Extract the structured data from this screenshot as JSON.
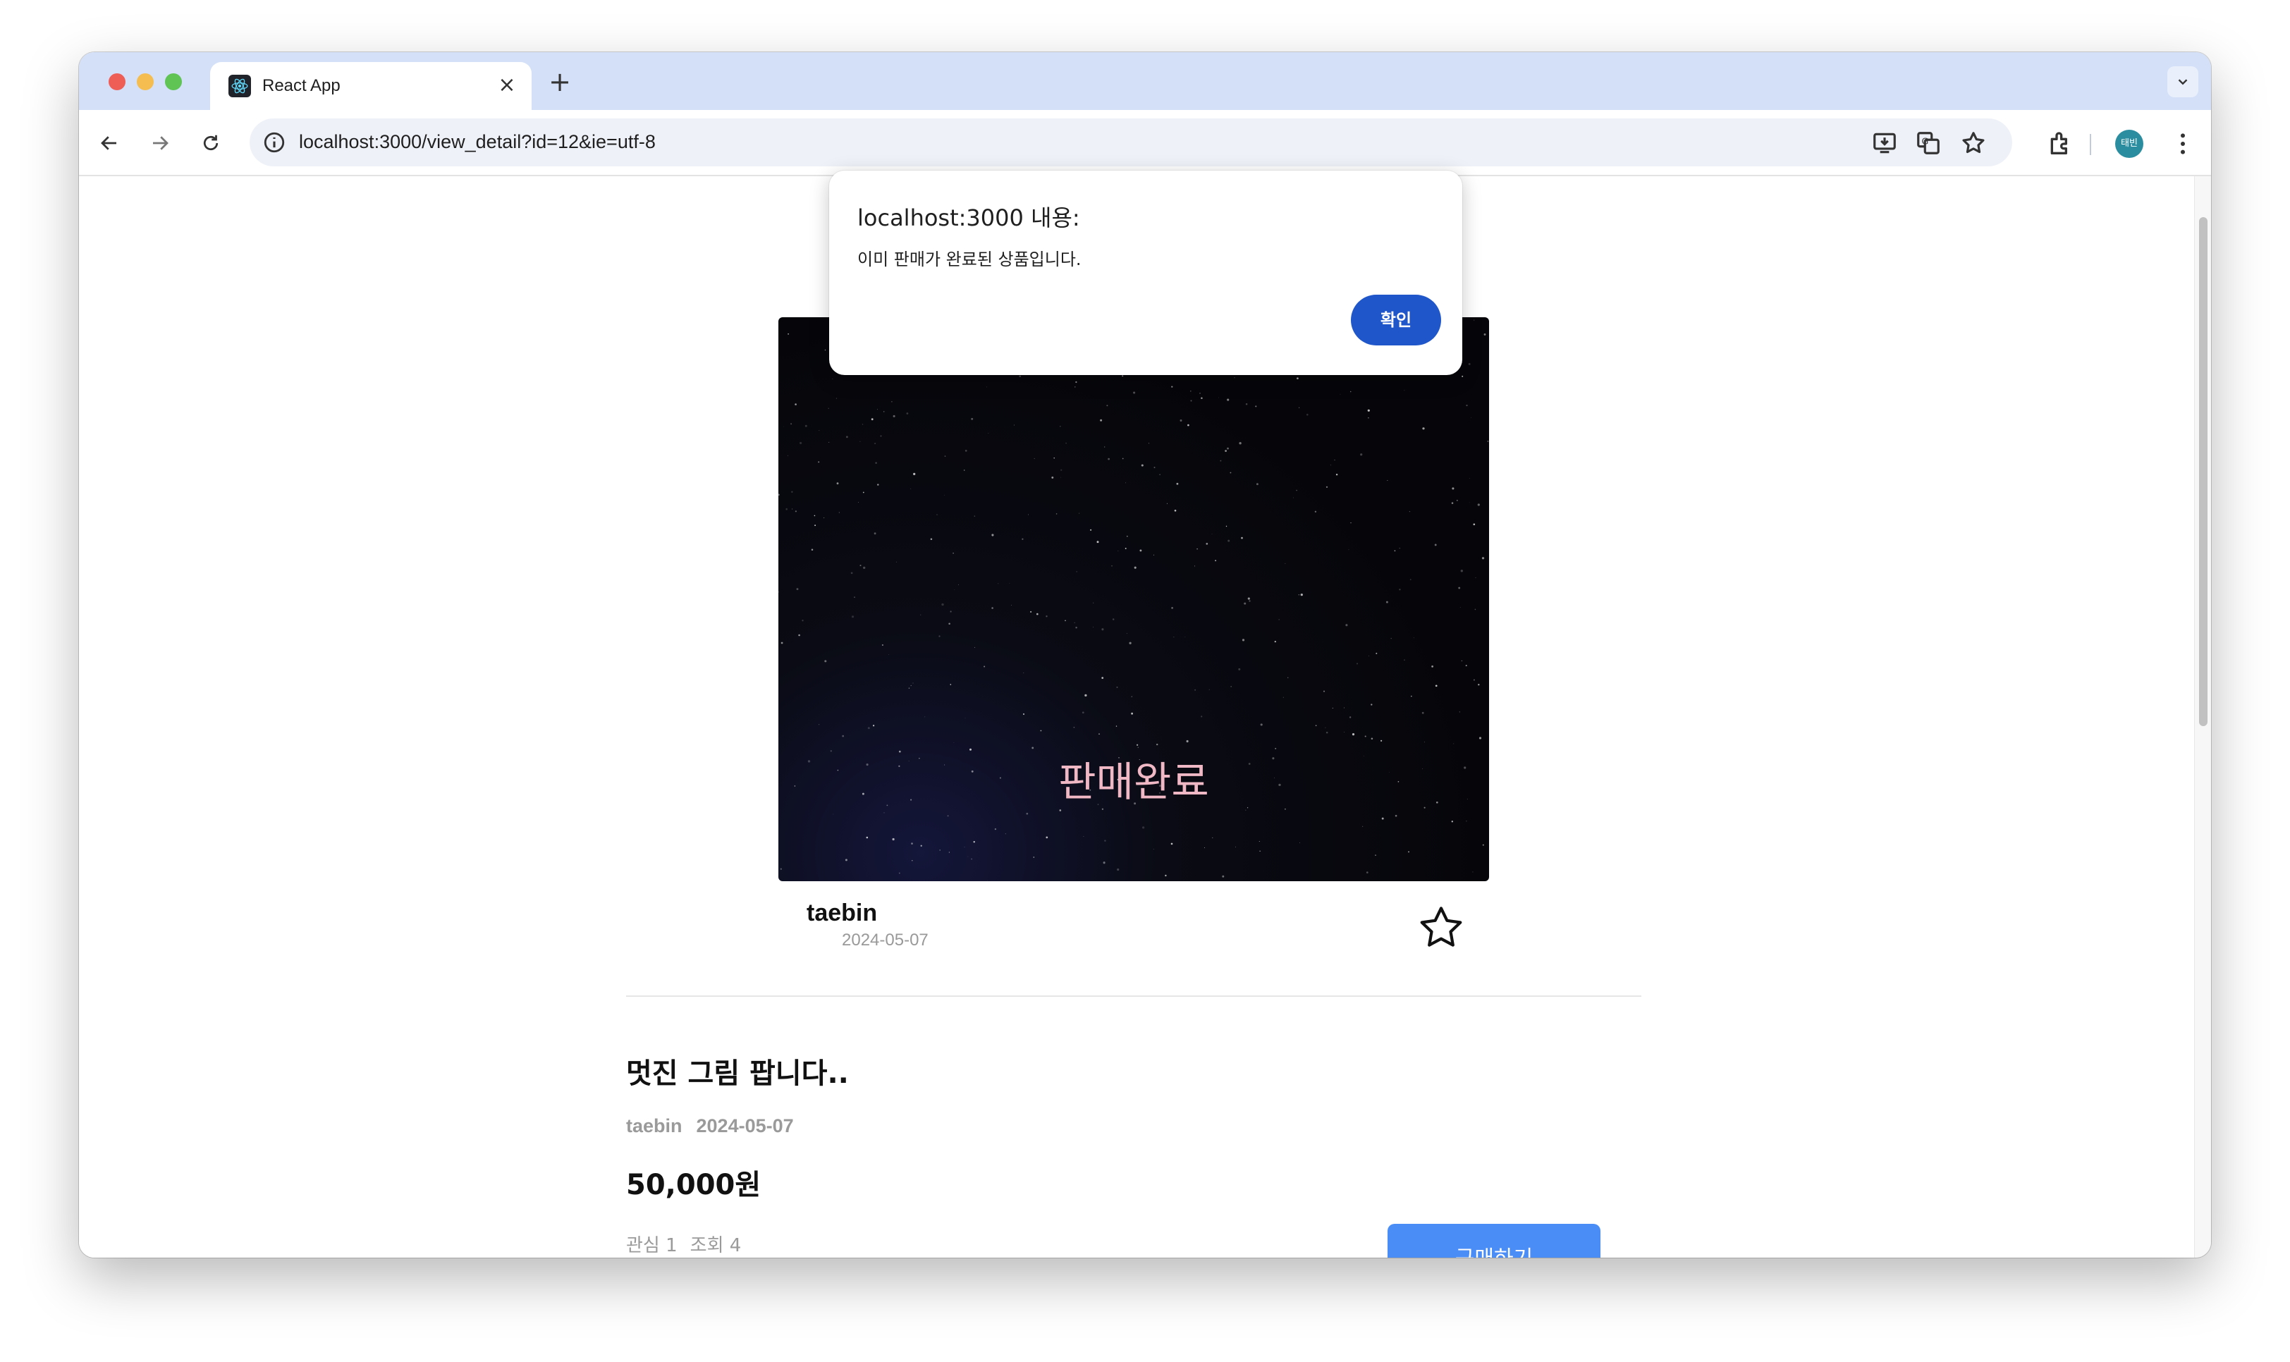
{
  "browser": {
    "tab_title": "React App",
    "url": "localhost:3000/view_detail?id=12&ie=utf-8",
    "profile_label": "태빈"
  },
  "product": {
    "sold_label": "판매완료",
    "seller": "taebin",
    "date": "2024-05-07"
  },
  "post": {
    "title": "멋진 그림 팝니다..",
    "author": "taebin",
    "date": "2024-05-07",
    "price": "50,000원",
    "likes": "관심 1",
    "views": "조회 4",
    "buy_label": "구매하기"
  },
  "dialog": {
    "title": "localhost:3000 내용:",
    "message": "이미 판매가 완료된 상품입니다.",
    "ok_label": "확인"
  },
  "colors": {
    "accent": "#4a8df6",
    "dialog_button": "#1f56c9",
    "tabbar": "#d3e0f8"
  },
  "icons": [
    "react-favicon",
    "back-arrow-icon",
    "forward-arrow-icon",
    "reload-icon",
    "info-icon",
    "install-icon",
    "translate-icon",
    "bookmark-star-icon",
    "extensions-icon",
    "kebab-menu-icon",
    "favorite-star-icon"
  ]
}
